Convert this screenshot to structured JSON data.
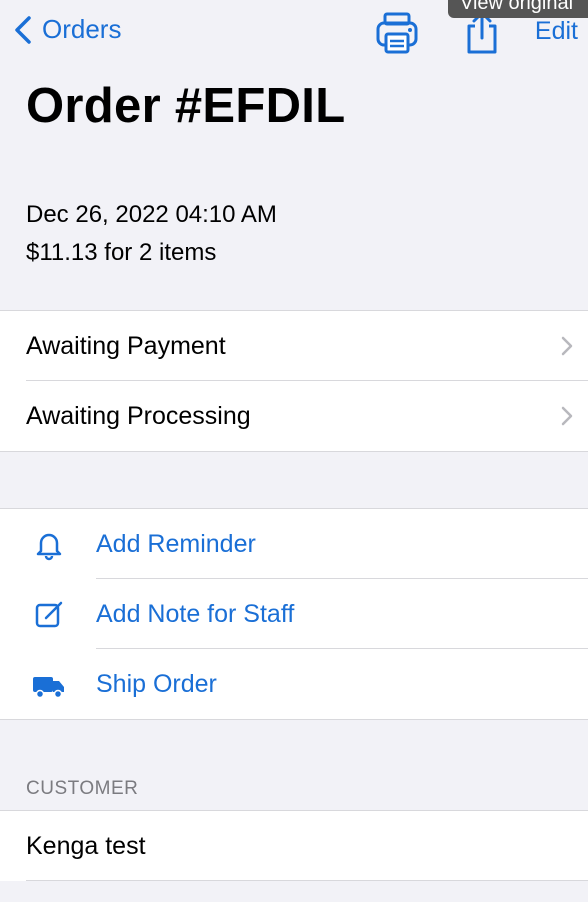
{
  "nav": {
    "back_label": "Orders",
    "edit_label": "Edit",
    "tooltip": "View original",
    "icons": [
      "chevron-left-icon",
      "printer-icon",
      "share-icon"
    ]
  },
  "order": {
    "title": "Order #EFDIL",
    "date": "Dec 26, 2022 04:10 AM",
    "summary": "$11.13 for 2 items"
  },
  "status": {
    "payment": "Awaiting Payment",
    "processing": "Awaiting Processing"
  },
  "actions": {
    "reminder": "Add Reminder",
    "note": "Add Note for Staff",
    "ship": "Ship Order"
  },
  "customer": {
    "header": "CUSTOMER",
    "name": "Kenga test"
  },
  "colors": {
    "accent": "#1a6fd6",
    "background": "#f2f2f7"
  }
}
